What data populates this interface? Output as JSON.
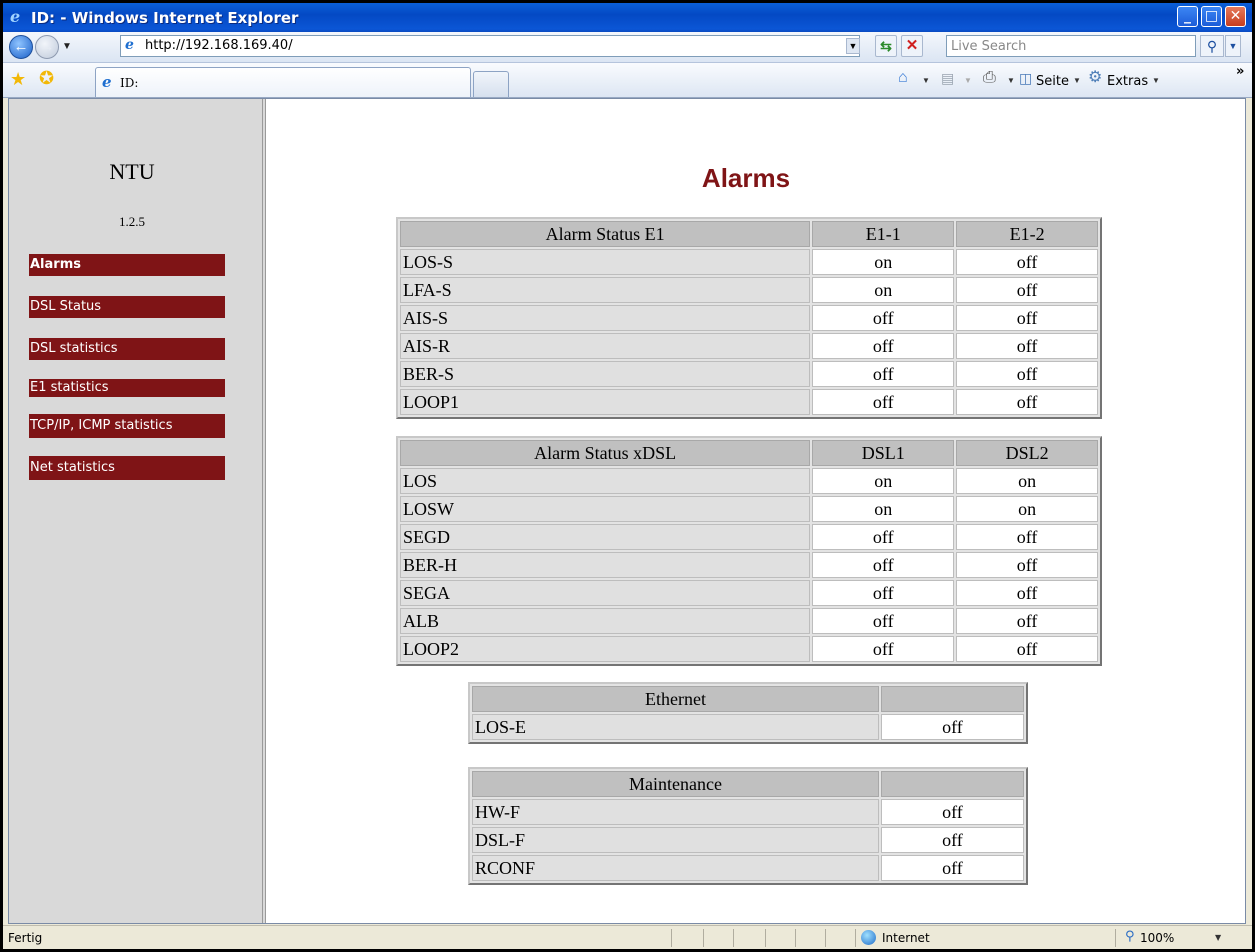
{
  "window": {
    "title": "ID: - Windows Internet Explorer",
    "buttons": {
      "minimize": "_",
      "maximize": "□",
      "close": "✕"
    }
  },
  "addressbar": {
    "url": "http://192.168.169.40/",
    "search_placeholder": "Live Search"
  },
  "tab": {
    "label": "ID:"
  },
  "toolbar": {
    "page_label": "Seite",
    "extras_label": "Extras"
  },
  "sidebar": {
    "title": "NTU",
    "version": "1.2.5",
    "items": [
      {
        "label": "Alarms",
        "selected": true
      },
      {
        "label": "DSL Status"
      },
      {
        "label": "DSL statistics"
      },
      {
        "label": "E1 statistics"
      },
      {
        "label": "TCP/IP, ICMP statistics"
      },
      {
        "label": "Net statistics"
      }
    ]
  },
  "main": {
    "title": "Alarms",
    "tables": [
      {
        "headers": [
          "Alarm Status E1",
          "E1-1",
          "E1-2"
        ],
        "rows": [
          [
            "LOS-S",
            "on",
            "off"
          ],
          [
            "LFA-S",
            "on",
            "off"
          ],
          [
            "AIS-S",
            "off",
            "off"
          ],
          [
            "AIS-R",
            "off",
            "off"
          ],
          [
            "BER-S",
            "off",
            "off"
          ],
          [
            "LOOP1",
            "off",
            "off"
          ]
        ]
      },
      {
        "headers": [
          "Alarm Status xDSL",
          "DSL1",
          "DSL2"
        ],
        "rows": [
          [
            "LOS",
            "on",
            "on"
          ],
          [
            "LOSW",
            "on",
            "on"
          ],
          [
            "SEGD",
            "off",
            "off"
          ],
          [
            "BER-H",
            "off",
            "off"
          ],
          [
            "SEGA",
            "off",
            "off"
          ],
          [
            "ALB",
            "off",
            "off"
          ],
          [
            "LOOP2",
            "off",
            "off"
          ]
        ]
      },
      {
        "headers": [
          "Ethernet",
          ""
        ],
        "rows": [
          [
            "LOS-E",
            "off"
          ]
        ]
      },
      {
        "headers": [
          "Maintenance",
          ""
        ],
        "rows": [
          [
            "HW-F",
            "off"
          ],
          [
            "DSL-F",
            "off"
          ],
          [
            "RCONF",
            "off"
          ]
        ]
      }
    ]
  },
  "statusbar": {
    "text": "Fertig",
    "zone": "Internet",
    "zoom": "100%"
  },
  "colors": {
    "nav_bg": "#7f1416",
    "title": "#7f1416",
    "sidebar_bg": "#d9d9d9"
  }
}
